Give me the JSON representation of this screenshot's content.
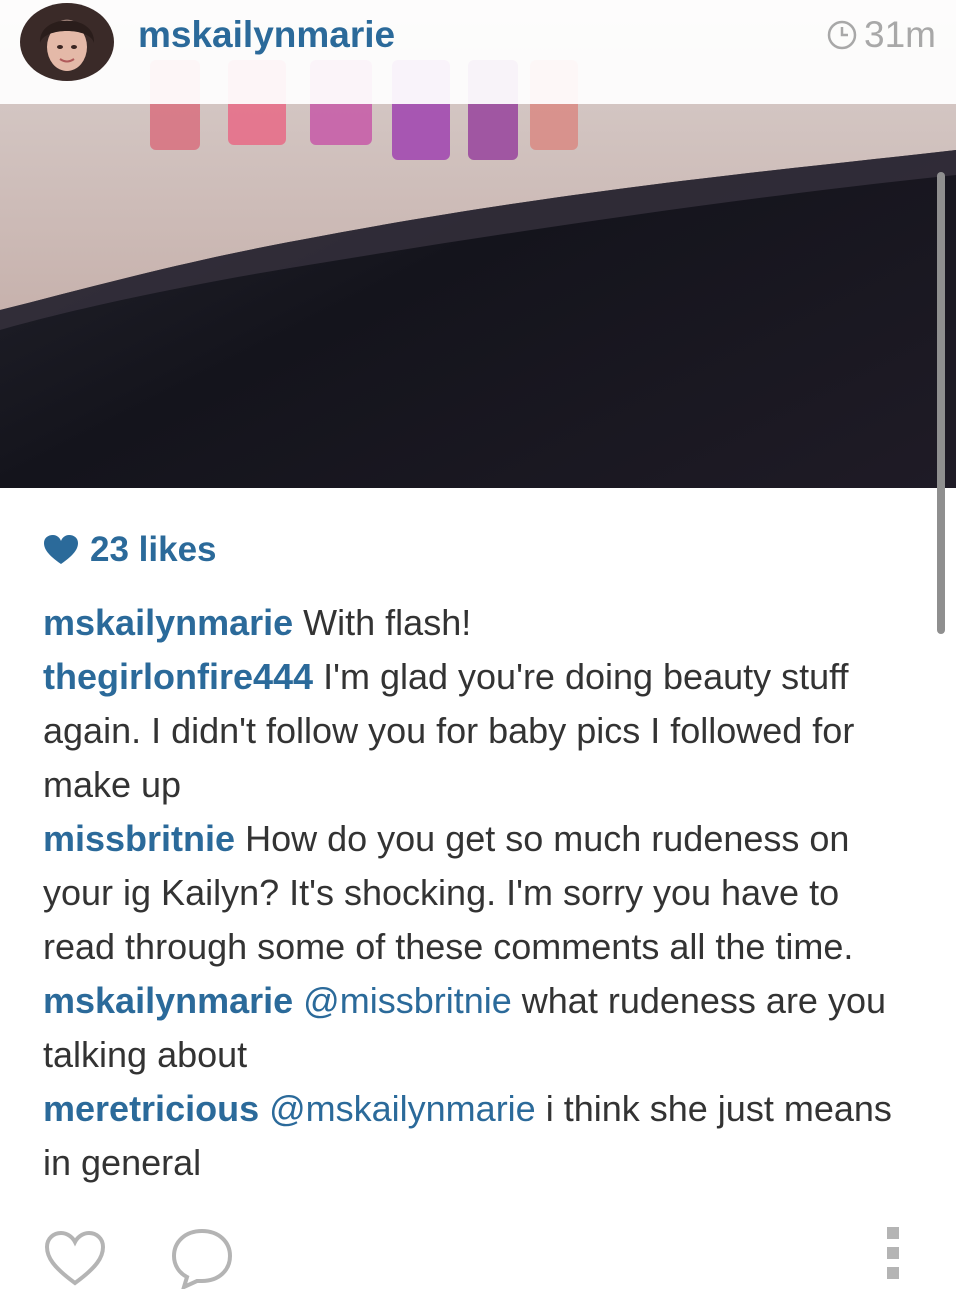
{
  "post": {
    "username": "mskailynmarie",
    "time": "31m",
    "likes": "23 likes",
    "comments": [
      {
        "author": "mskailynmarie",
        "mention": "",
        "text": "With flash!"
      },
      {
        "author": "thegirlonfire444",
        "mention": "",
        "text": "I'm glad you're doing beauty stuff again. I didn't follow you for baby pics I followed for make up"
      },
      {
        "author": "missbritnie",
        "mention": "",
        "text": "How do you get so much rudeness on your ig Kailyn? It's shocking. I'm sorry you have to read through some of these comments all the time."
      },
      {
        "author": "mskailynmarie",
        "mention": "@missbritnie",
        "text": "what rudeness are you talking about"
      },
      {
        "author": "meretricious",
        "mention": "@mskailynmarie",
        "text": "i think she just means in general"
      }
    ]
  },
  "icons": {
    "clock": "clock-icon",
    "heart": "heart-icon",
    "like_button": "heart-outline-icon",
    "comment_button": "speech-bubble-icon",
    "more_button": "more-dots-icon"
  },
  "colors": {
    "accent": "#2b6a9a",
    "text": "#333333",
    "muted": "#a8a8a8"
  }
}
